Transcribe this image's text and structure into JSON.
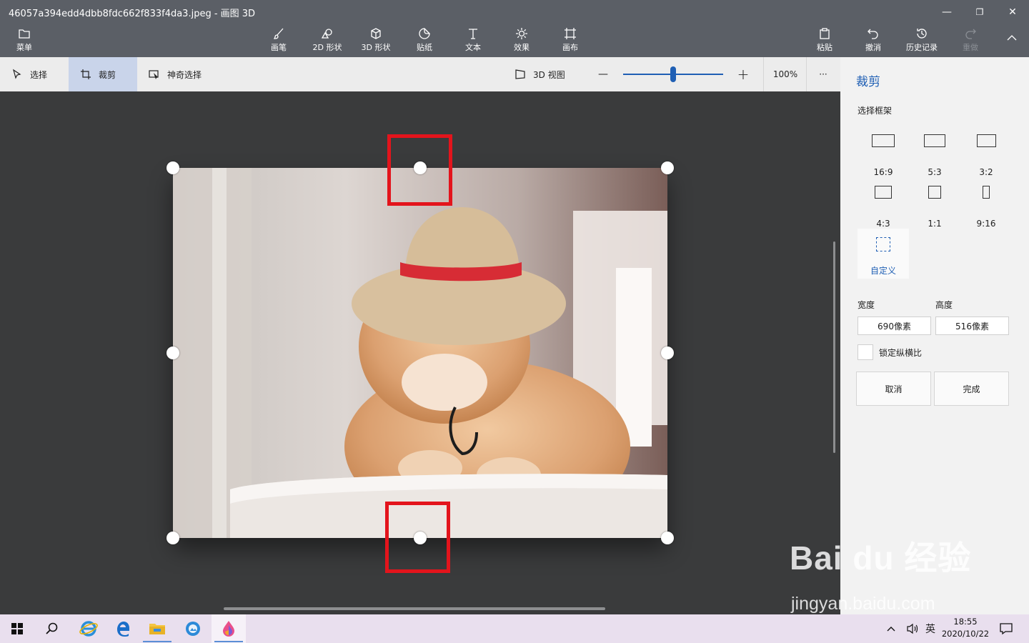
{
  "window": {
    "title": "46057a394edd4dbb8fdc662f833f4da3.jpeg - 画图 3D",
    "minimize_glyph": "—",
    "maximize_glyph": "❐",
    "close_glyph": "✕"
  },
  "ribbon": {
    "menu_label": "菜单",
    "tools": [
      {
        "label": "画笔",
        "icon": "brush-icon"
      },
      {
        "label": "2D 形状",
        "icon": "shapes-2d-icon"
      },
      {
        "label": "3D 形状",
        "icon": "cube-icon"
      },
      {
        "label": "贴纸",
        "icon": "sticker-icon"
      },
      {
        "label": "文本",
        "icon": "text-icon"
      },
      {
        "label": "效果",
        "icon": "effects-icon"
      },
      {
        "label": "画布",
        "icon": "canvas-icon"
      }
    ],
    "paste_label": "粘贴",
    "undo_label": "撤消",
    "history_label": "历史记录",
    "redo_label": "重做"
  },
  "subbar": {
    "select_label": "选择",
    "crop_label": "裁剪",
    "magic_select_label": "神奇选择",
    "view3d_label": "3D 视图",
    "zoom_out_glyph": "—",
    "zoom_in_glyph": "+",
    "zoom_percent": "100%",
    "zoom_fraction": 0.5,
    "more_glyph": "···"
  },
  "panel": {
    "title": "裁剪",
    "frame_section": "选择框架",
    "ratios": [
      "16:9",
      "5:3",
      "3:2",
      "4:3",
      "1:1",
      "9:16"
    ],
    "custom_label": "自定义",
    "width_label": "宽度",
    "height_label": "高度",
    "width_value": "690像素",
    "height_value": "516像素",
    "lock_label": "锁定纵横比",
    "cancel_label": "取消",
    "done_label": "完成"
  },
  "taskbar": {
    "ime": "英",
    "time": "18:55",
    "date": "2020/10/22"
  },
  "watermark": {
    "brand": "Bai du 经验",
    "url": "jingyan.baidu.com"
  },
  "colors": {
    "accent": "#1f5fb4",
    "highlight_box": "#e3141c",
    "ribbon_bg": "#5b5f66"
  }
}
